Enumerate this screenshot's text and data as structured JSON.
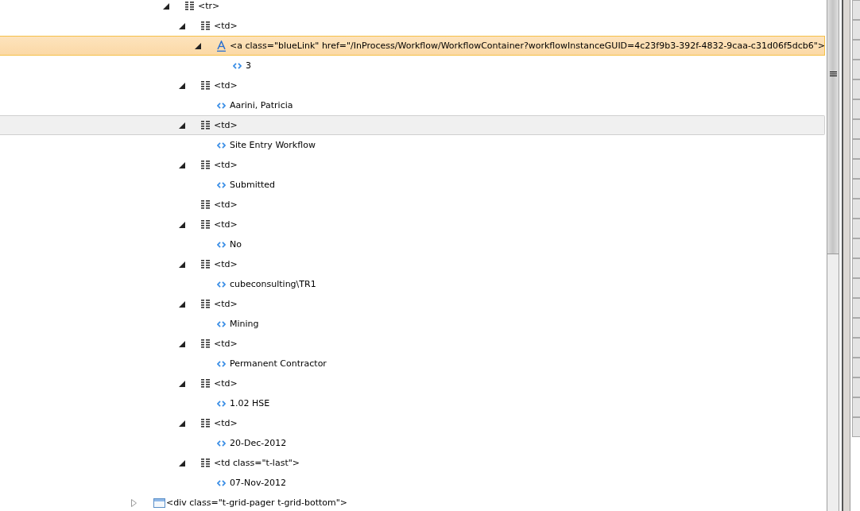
{
  "tree": [
    {
      "kind": "row",
      "label": "<tr>",
      "expanded": true,
      "selected": false,
      "hovered": false,
      "children": [
        {
          "kind": "row",
          "label": "<td>",
          "expanded": true,
          "selected": false,
          "hovered": false,
          "children": [
            {
              "kind": "link",
              "label": "<a class=\"blueLink\" href=\"/InProcess/Workflow/WorkflowContainer?workflowInstanceGUID=4c23f9b3-392f-4832-9caa-c31d06f5dcb6\">",
              "expanded": true,
              "selected": true,
              "hovered": false,
              "children": [
                {
                  "kind": "text",
                  "label": "3",
                  "selected": false,
                  "hovered": false
                }
              ]
            }
          ]
        },
        {
          "kind": "row",
          "label": "<td>",
          "expanded": true,
          "selected": false,
          "hovered": false,
          "children": [
            {
              "kind": "text",
              "label": "Aarini, Patricia",
              "selected": false,
              "hovered": false
            }
          ]
        },
        {
          "kind": "row",
          "label": "<td>",
          "expanded": true,
          "selected": false,
          "hovered": true,
          "children": [
            {
              "kind": "text",
              "label": "Site Entry Workflow",
              "selected": false,
              "hovered": false
            }
          ]
        },
        {
          "kind": "row",
          "label": "<td>",
          "expanded": true,
          "selected": false,
          "hovered": false,
          "children": [
            {
              "kind": "text",
              "label": "Submitted",
              "selected": false,
              "hovered": false
            }
          ]
        },
        {
          "kind": "row",
          "label": "<td>",
          "selected": false,
          "hovered": false
        },
        {
          "kind": "row",
          "label": "<td>",
          "expanded": true,
          "selected": false,
          "hovered": false,
          "children": [
            {
              "kind": "text",
              "label": "No",
              "selected": false,
              "hovered": false
            }
          ]
        },
        {
          "kind": "row",
          "label": "<td>",
          "expanded": true,
          "selected": false,
          "hovered": false,
          "children": [
            {
              "kind": "text",
              "label": "cubeconsulting\\TR1",
              "selected": false,
              "hovered": false
            }
          ]
        },
        {
          "kind": "row",
          "label": "<td>",
          "expanded": true,
          "selected": false,
          "hovered": false,
          "children": [
            {
              "kind": "text",
              "label": "Mining",
              "selected": false,
              "hovered": false
            }
          ]
        },
        {
          "kind": "row",
          "label": "<td>",
          "expanded": true,
          "selected": false,
          "hovered": false,
          "children": [
            {
              "kind": "text",
              "label": "Permanent Contractor",
              "selected": false,
              "hovered": false
            }
          ]
        },
        {
          "kind": "row",
          "label": "<td>",
          "expanded": true,
          "selected": false,
          "hovered": false,
          "children": [
            {
              "kind": "text",
              "label": "1.02 HSE",
              "selected": false,
              "hovered": false
            }
          ]
        },
        {
          "kind": "row",
          "label": "<td>",
          "expanded": true,
          "selected": false,
          "hovered": false,
          "children": [
            {
              "kind": "text",
              "label": "20-Dec-2012",
              "selected": false,
              "hovered": false
            }
          ]
        },
        {
          "kind": "row",
          "label": "<td class=\"t-last\">",
          "expanded": true,
          "selected": false,
          "hovered": false,
          "children": [
            {
              "kind": "text",
              "label": "07-Nov-2012",
              "selected": false,
              "hovered": false
            }
          ]
        }
      ]
    }
  ],
  "outer_tree": [
    {
      "kind": "block",
      "label": "<div class=\"t-grid-pager t-grid-bottom\">",
      "expanded": false,
      "selected": false,
      "hovered": false
    }
  ]
}
